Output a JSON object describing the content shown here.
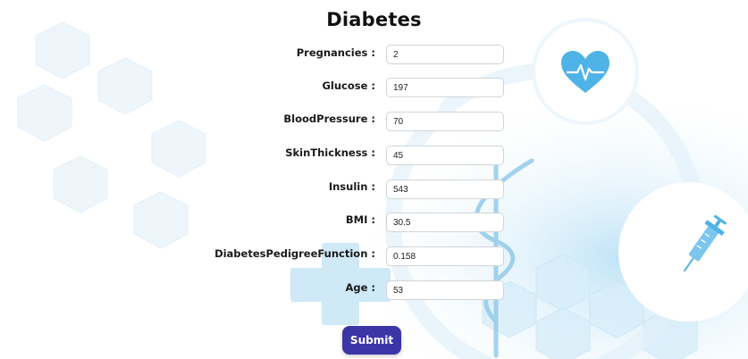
{
  "page": {
    "title": "Diabetes"
  },
  "form": {
    "fields": [
      {
        "label": "Pregnancies :",
        "value": "2"
      },
      {
        "label": "Glucose :",
        "value": "197"
      },
      {
        "label": "BloodPressure :",
        "value": "70"
      },
      {
        "label": "SkinThickness :",
        "value": "45"
      },
      {
        "label": "Insulin :",
        "value": "543"
      },
      {
        "label": "BMI :",
        "value": "30.5"
      },
      {
        "label": "DiabetesPedigreeFunction :",
        "value": "0.158"
      },
      {
        "label": "Age :",
        "value": "53"
      }
    ],
    "submit_label": "Submit"
  },
  "colors": {
    "accent": "#3b36a8",
    "background_tint": "#cfe8f7",
    "icon_blue": "#4fb3e8"
  },
  "icons": [
    "heart-pulse-icon",
    "syringe-icon",
    "caduceus-icon",
    "medical-cross-icon"
  ]
}
